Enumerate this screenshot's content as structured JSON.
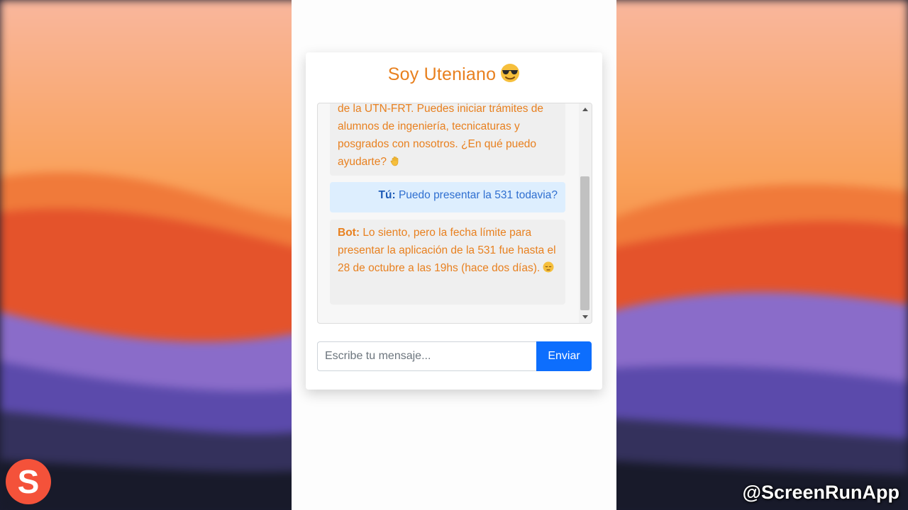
{
  "chat": {
    "title": "Soy Uteniano",
    "title_emoji": "smiling-face-with-sunglasses-icon",
    "messages": [
      {
        "sender": "",
        "text": "de la UTN-FRT. Puedes iniciar trámites de alumnos de ingeniería, tecnicaturas y posgrados con nosotros. ¿En qué puedo ayudarte?",
        "emoji": "waving-hand-icon"
      },
      {
        "sender": "Tú:",
        "text": "Puedo presentar la 531 todavia?"
      },
      {
        "sender": "Bot:",
        "text": "Lo siento, pero la fecha límite para presentar la aplicación de la 531 fue hasta el 28 de octubre a las 19hs (hace dos días).",
        "emoji": "pensive-face-icon"
      }
    ],
    "input_placeholder": "Escribe tu mensaje...",
    "send_label": "Enviar"
  },
  "overlay": {
    "logo_letter": "S",
    "watermark": "@ScreenRunApp"
  },
  "colors": {
    "title": "#e8801f",
    "bot_text": "#e8801f",
    "user_text": "#2f6fd0",
    "user_bubble": "#ddeefe",
    "bot_bubble": "#efefef",
    "send_button": "#0d6efd",
    "logo": "#f4523a"
  }
}
